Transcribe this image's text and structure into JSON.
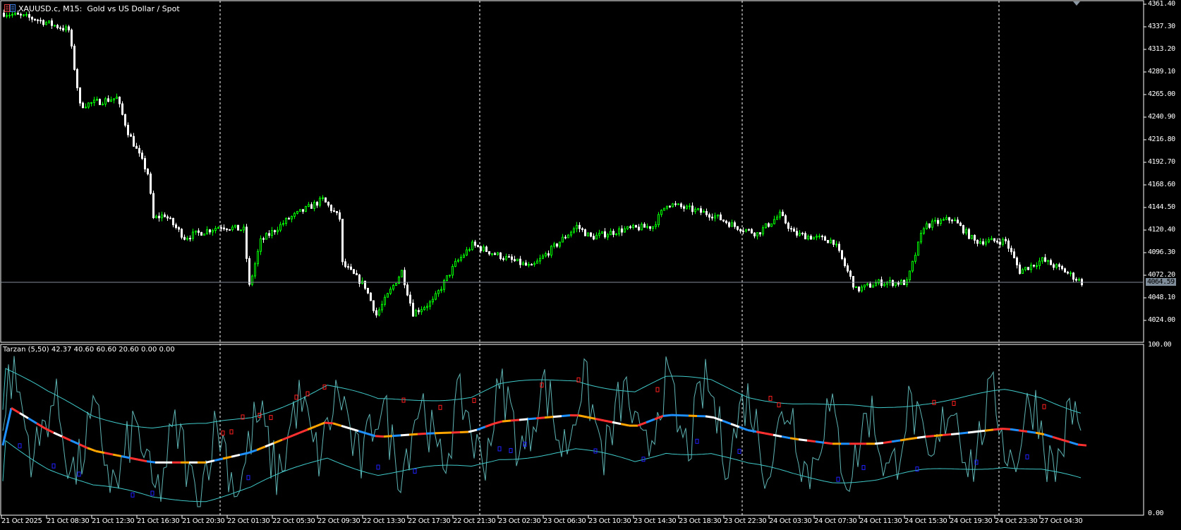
{
  "header": {
    "title": "XAUUSD.c, M15:  Gold vs US Dollar / Spot",
    "icon": "chart-window-icon"
  },
  "indicator": {
    "label": "Tarzan (5,50) 42.37 40.60 60.60 20.60 0.00 0.00",
    "axis": [
      "100.00",
      "0.00"
    ]
  },
  "price_axis": [
    "4361.40",
    "4337.30",
    "4313.20",
    "4289.10",
    "4265.00",
    "4240.90",
    "4216.80",
    "4192.70",
    "4168.60",
    "4144.50",
    "4120.40",
    "4096.30",
    "4072.20",
    "4048.10",
    "4024.00"
  ],
  "current_price": "4064.59",
  "time_axis": [
    "21 Oct 2025",
    "21 Oct 08:30",
    "21 Oct 12:30",
    "21 Oct 16:30",
    "21 Oct 20:30",
    "22 Oct 01:30",
    "22 Oct 05:30",
    "22 Oct 09:30",
    "22 Oct 13:30",
    "22 Oct 17:30",
    "22 Oct 21:30",
    "23 Oct 02:30",
    "23 Oct 06:30",
    "23 Oct 10:30",
    "23 Oct 14:30",
    "23 Oct 18:30",
    "23 Oct 22:30",
    "24 Oct 03:30",
    "24 Oct 07:30",
    "24 Oct 11:30",
    "24 Oct 15:30",
    "24 Oct 19:30",
    "24 Oct 23:30",
    "27 Oct 04:30"
  ],
  "colors": {
    "bull": "#00ff00",
    "bear": "#ffffff",
    "grid": "#ffffff",
    "band": "#40c8c8",
    "osc": "#5fb4b4",
    "mid": [
      "#ffffff",
      "#ffa500",
      "#1e90ff",
      "#ff3030"
    ],
    "up_marker": "#ff2020",
    "down_marker": "#2020ff"
  },
  "chart_data": {
    "type": "candlestick",
    "symbol": "XAUUSD.c",
    "timeframe": "M15",
    "ylim": [
      4024.0,
      4361.4
    ],
    "bars": 383,
    "day_separator_bars": [
      77,
      169,
      262,
      353
    ],
    "price_path": [
      [
        0,
        4352
      ],
      [
        11,
        4345.8
      ],
      [
        23,
        4333.8
      ],
      [
        27,
        4253.3
      ],
      [
        40,
        4261.4
      ],
      [
        44,
        4225.2
      ],
      [
        51,
        4181
      ],
      [
        53,
        4132.7
      ],
      [
        57,
        4136.7
      ],
      [
        64,
        4112.6
      ],
      [
        77,
        4124.6
      ],
      [
        85,
        4120.6
      ],
      [
        87,
        4060.4
      ],
      [
        91,
        4108.6
      ],
      [
        101,
        4132.7
      ],
      [
        113,
        4152.9
      ],
      [
        119,
        4132.7
      ],
      [
        120,
        4084.5
      ],
      [
        128,
        4060.4
      ],
      [
        132,
        4030
      ],
      [
        141,
        4076.5
      ],
      [
        145,
        4032
      ],
      [
        152,
        4044.3
      ],
      [
        160,
        4084.5
      ],
      [
        166,
        4104.6
      ],
      [
        176,
        4092.5
      ],
      [
        187,
        4080.5
      ],
      [
        203,
        4124.6
      ],
      [
        208,
        4112.6
      ],
      [
        219,
        4120.6
      ],
      [
        230,
        4124.6
      ],
      [
        235,
        4148.8
      ],
      [
        251,
        4136.7
      ],
      [
        259,
        4124.6
      ],
      [
        267,
        4116.6
      ],
      [
        275,
        4136.7
      ],
      [
        280,
        4116.6
      ],
      [
        294,
        4108.6
      ],
      [
        302,
        4056.4
      ],
      [
        310,
        4064.4
      ],
      [
        320,
        4064.4
      ],
      [
        326,
        4124.6
      ],
      [
        336,
        4132.7
      ],
      [
        344,
        4108.6
      ],
      [
        355,
        4108.6
      ],
      [
        360,
        4076.5
      ],
      [
        368,
        4088.5
      ],
      [
        376,
        4076.5
      ],
      [
        382,
        4064.6
      ]
    ],
    "indicator": {
      "ylim": [
        0,
        100
      ],
      "mid_path": [
        [
          1,
          65
        ],
        [
          16,
          50
        ],
        [
          32,
          38
        ],
        [
          53,
          31
        ],
        [
          72,
          31
        ],
        [
          88,
          37
        ],
        [
          115,
          55
        ],
        [
          133,
          46
        ],
        [
          150,
          48
        ],
        [
          166,
          49
        ],
        [
          176,
          55
        ],
        [
          203,
          59
        ],
        [
          224,
          52
        ],
        [
          235,
          59
        ],
        [
          251,
          58
        ],
        [
          264,
          50
        ],
        [
          280,
          45
        ],
        [
          294,
          42
        ],
        [
          310,
          42
        ],
        [
          326,
          46
        ],
        [
          339,
          48
        ],
        [
          355,
          51
        ],
        [
          368,
          48
        ],
        [
          382,
          41
        ]
      ],
      "band_width": 21,
      "up_markers": [
        78,
        81,
        85,
        91,
        95,
        104,
        108,
        114,
        142,
        155,
        167,
        191,
        204,
        232,
        272,
        275,
        330,
        337,
        369
      ],
      "down_markers": [
        6,
        18,
        27,
        46,
        53,
        87,
        133,
        146,
        176,
        180,
        185,
        210,
        227,
        246,
        261,
        296,
        305,
        324,
        345,
        363
      ]
    }
  }
}
